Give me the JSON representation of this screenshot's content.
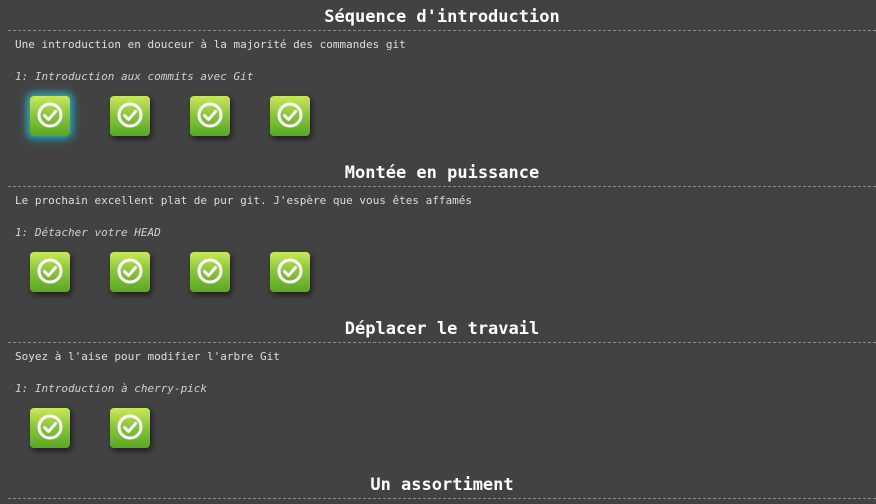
{
  "sequences": [
    {
      "title": "Séquence d'introduction",
      "description": "Une introduction en douceur à la majorité des commandes git",
      "level_name": "1: Introduction aux commits avec Git",
      "levels": [
        {
          "completed": true,
          "selected": true
        },
        {
          "completed": true,
          "selected": false
        },
        {
          "completed": true,
          "selected": false
        },
        {
          "completed": true,
          "selected": false
        }
      ]
    },
    {
      "title": "Montée en puissance",
      "description": "Le prochain excellent plat de pur git. J'espère que vous êtes affamés",
      "level_name": "1: Détacher votre HEAD",
      "levels": [
        {
          "completed": true,
          "selected": false
        },
        {
          "completed": true,
          "selected": false
        },
        {
          "completed": true,
          "selected": false
        },
        {
          "completed": true,
          "selected": false
        }
      ]
    },
    {
      "title": "Déplacer le travail",
      "description": "Soyez à l'aise pour modifier l'arbre Git",
      "level_name": "1: Introduction à cherry-pick",
      "levels": [
        {
          "completed": true,
          "selected": false
        },
        {
          "completed": true,
          "selected": false
        }
      ]
    },
    {
      "title": "Un assortiment"
    }
  ],
  "colors": {
    "background": "#424242",
    "level_box_top": "#c9e85a",
    "level_box_bottom": "#5aa823",
    "selected_glow": "#2fb7c9"
  },
  "icons": {
    "level_status": "checkmark-circle-icon"
  }
}
